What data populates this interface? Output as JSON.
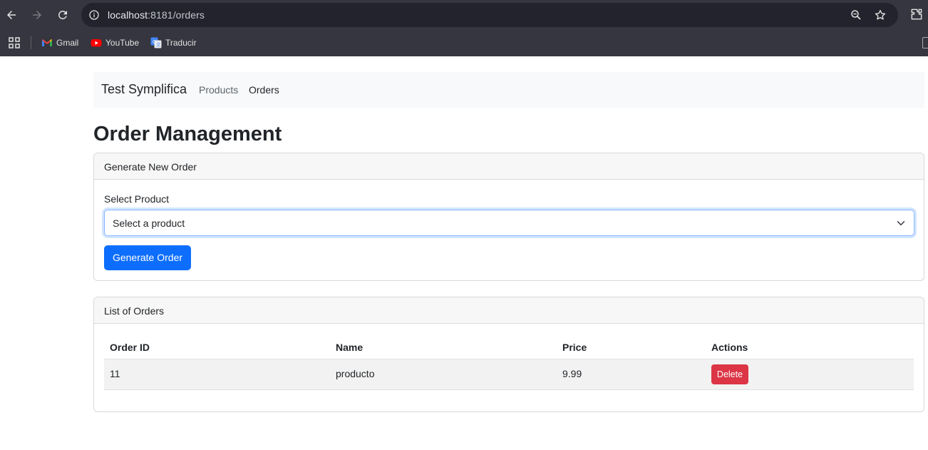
{
  "browser": {
    "url_host": "localhost",
    "url_rest": ":8181/orders",
    "bookmarks": [
      {
        "label": "Gmail",
        "icon": "gmail-icon"
      },
      {
        "label": "YouTube",
        "icon": "youtube-icon"
      },
      {
        "label": "Traducir",
        "icon": "translate-icon"
      }
    ]
  },
  "navbar": {
    "brand": "Test Symplifica",
    "links": [
      {
        "label": "Products",
        "active": false
      },
      {
        "label": "Orders",
        "active": true
      }
    ]
  },
  "page": {
    "title": "Order Management"
  },
  "generate_card": {
    "header": "Generate New Order",
    "select_label": "Select Product",
    "select_value": "Select a product",
    "button_label": "Generate Order"
  },
  "orders_card": {
    "header": "List of Orders",
    "columns": [
      "Order ID",
      "Name",
      "Price",
      "Actions"
    ],
    "rows": [
      {
        "id": "11",
        "name": "producto",
        "price": "9.99",
        "action": "Delete"
      }
    ]
  },
  "colors": {
    "chrome": "#35363f",
    "primary": "#0d6efd",
    "danger": "#dc3545"
  }
}
